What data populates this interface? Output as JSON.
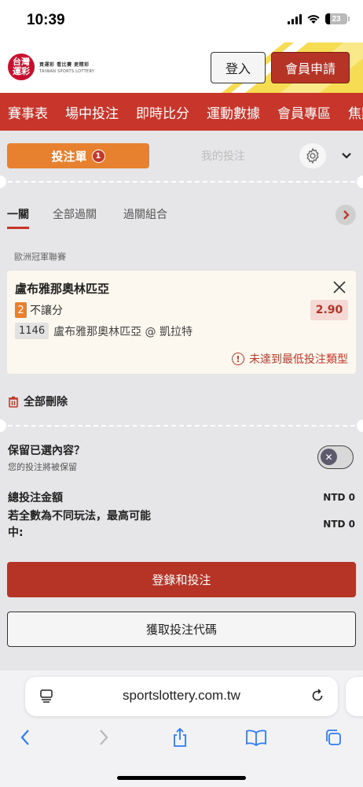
{
  "status": {
    "time": "10:39",
    "battery": "23"
  },
  "header": {
    "logo_text": "台灣運彩",
    "logo_tagline": "買運彩  看比賽  更精彩",
    "logo_english": "TAIWAN SPORTS LOTTERY",
    "login_label": "登入",
    "register_label": "會員申請"
  },
  "nav": {
    "items": [
      "賽事表",
      "場中投注",
      "即時比分",
      "運動數據",
      "會員專區",
      "焦點"
    ]
  },
  "betslip": {
    "tab_bet_label": "投注單",
    "tab_bet_count": "1",
    "tab_my_label": "我的投注",
    "subtabs": [
      "一關",
      "全部過關",
      "過關組合"
    ],
    "league": "歐洲冠軍聯賽",
    "selection": {
      "team": "盧布雅那奧林匹亞",
      "number": "2",
      "bet_type": "不讓分",
      "odds": "2.90",
      "code": "1146",
      "match": "盧布雅那奧林匹亞 @ 凱拉特",
      "warning": "未達到最低投注類型"
    },
    "delete_all_label": "全部刪除",
    "keep_title": "保留已選內容？",
    "keep_sub": "您的投注將被保留",
    "keep_enabled": false,
    "total_label": "總投注金額",
    "total_value": "NTD 0",
    "max_win_label_line1": "若全數為不同玩法，最高可能",
    "max_win_label_line2": "中:",
    "max_win_value": "NTD 0",
    "login_bet_label": "登錄和投注",
    "get_code_label": "獲取投注代碼"
  },
  "browser": {
    "url": "sportslottery.com.tw"
  },
  "colors": {
    "brand_red": "#c8352a",
    "accent_orange": "#e8812f",
    "button_red": "#b53426",
    "panel_bg": "#e6e6e8"
  },
  "icons": [
    "signal-icon",
    "wifi-icon",
    "battery-icon",
    "gear-icon",
    "chevron-down-icon",
    "chevron-right-icon",
    "close-icon",
    "warning-icon",
    "trash-icon",
    "page-menu-icon",
    "reload-icon",
    "back-icon",
    "forward-icon",
    "share-icon",
    "bookmarks-icon",
    "tabs-icon"
  ]
}
